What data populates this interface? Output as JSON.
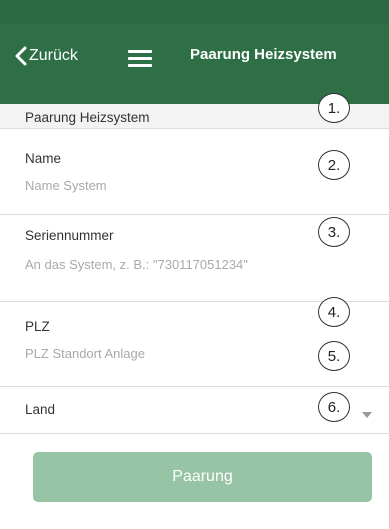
{
  "header": {
    "back_label": "Zurück",
    "title": "Paarung Heizsystem"
  },
  "form": {
    "section_title": "Paarung Heizsystem",
    "name": {
      "label": "Name",
      "placeholder": "Name System",
      "value": ""
    },
    "serial": {
      "label": "Seriennummer",
      "placeholder": "An das System, z. B.: \"730117051234\"",
      "value": ""
    },
    "zip": {
      "label": "PLZ",
      "placeholder": "PLZ Standort Anlage",
      "value": ""
    },
    "country": {
      "label": "Land",
      "value": ""
    }
  },
  "callouts": [
    "1.",
    "2.",
    "3.",
    "4.",
    "5.",
    "6."
  ],
  "submit": {
    "label": "Paarung",
    "enabled": false
  },
  "colors": {
    "header_bg": "#2e6f46",
    "button_bg": "#96c4a5",
    "section_bg": "#f3f3f3"
  },
  "icons": [
    "chevron-left-icon",
    "hamburger-menu-icon",
    "dropdown-caret-icon"
  ]
}
